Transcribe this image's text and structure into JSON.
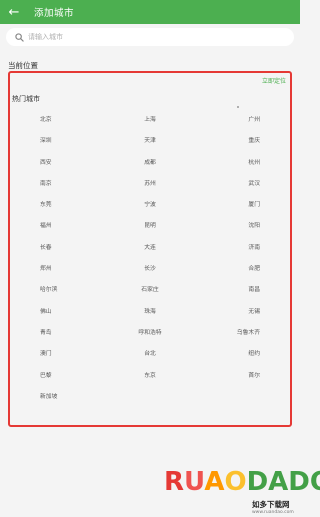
{
  "appbar": {
    "title": "添加城市",
    "back_icon": "arrow-left-icon",
    "background_color": "#4caf50"
  },
  "search": {
    "placeholder": "请输入城市",
    "value": ""
  },
  "current_location": {
    "section_title": "当前位置",
    "locate_label": "立即定位"
  },
  "hot_cities": {
    "section_title": "热门城市",
    "cities": [
      "北京",
      "上海",
      "广州",
      "深圳",
      "天津",
      "重庆",
      "西安",
      "成都",
      "杭州",
      "南京",
      "苏州",
      "武汉",
      "东莞",
      "宁波",
      "厦门",
      "福州",
      "昆明",
      "沈阳",
      "长春",
      "大连",
      "济南",
      "郑州",
      "长沙",
      "合肥",
      "哈尔滨",
      "石家庄",
      "南昌",
      "佛山",
      "珠海",
      "无锡",
      "青岛",
      "呼和浩特",
      "乌鲁木齐",
      "澳门",
      "台北",
      "纽约",
      "巴黎",
      "东京",
      "首尔",
      "新加坡"
    ]
  },
  "highlight_color": "#e53935",
  "watermark": {
    "logo": "RUANDADO",
    "tagline": "如多下载网",
    "url": "www.ruandao.com"
  }
}
